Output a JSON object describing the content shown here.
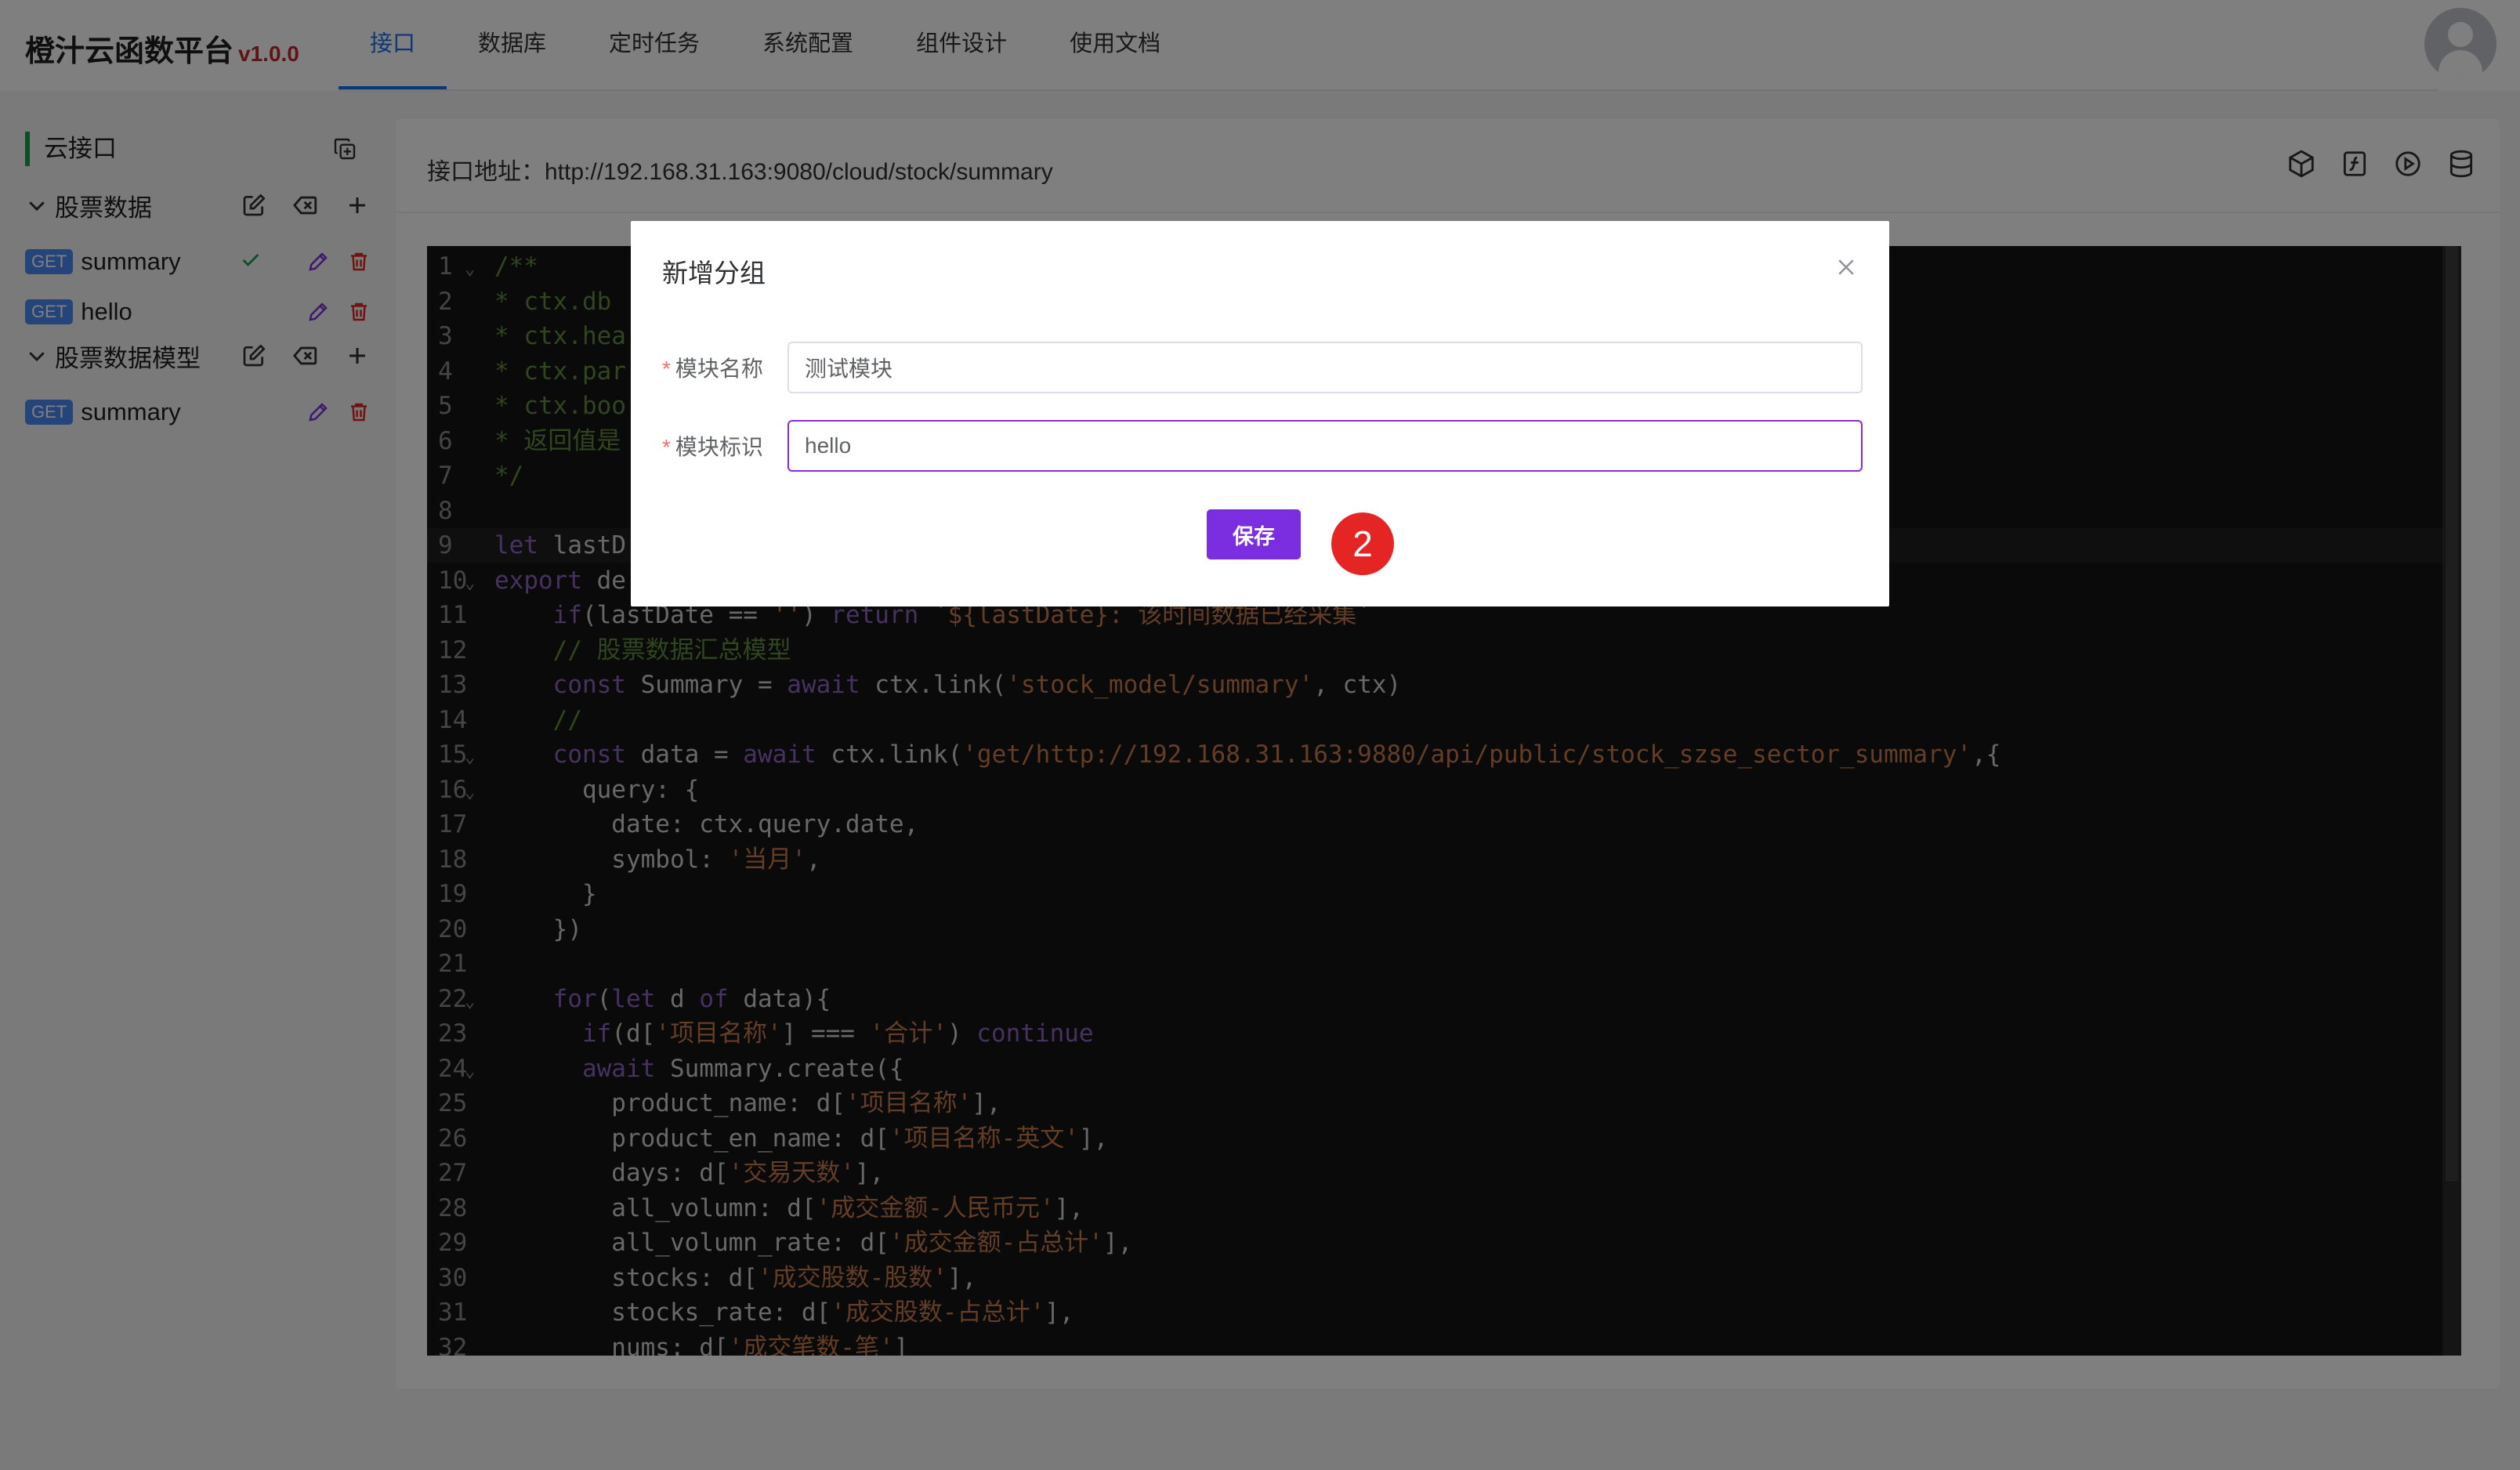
{
  "header": {
    "brand": "橙汁云函数平台",
    "version": "v1.0.0",
    "nav": [
      {
        "label": "接口",
        "active": true
      },
      {
        "label": "数据库",
        "active": false
      },
      {
        "label": "定时任务",
        "active": false
      },
      {
        "label": "系统配置",
        "active": false
      },
      {
        "label": "组件设计",
        "active": false
      },
      {
        "label": "使用文档",
        "active": false
      }
    ]
  },
  "sidebar": {
    "title": "云接口",
    "groups": [
      {
        "name": "股票数据",
        "apis": [
          {
            "method": "GET",
            "name": "summary"
          },
          {
            "method": "GET",
            "name": "hello"
          }
        ]
      },
      {
        "name": "股票数据模型",
        "apis": [
          {
            "method": "GET",
            "name": "summary"
          }
        ]
      }
    ]
  },
  "main": {
    "address_label": "接口地址：",
    "address_url": "http://192.168.31.163:9080/cloud/stock/summary"
  },
  "editor": {
    "lines": [
      "/**",
      "* ctx.db",
      "* ctx.hea",
      "* ctx.par",
      "* ctx.boo",
      "* 返回值是",
      "*/",
      "",
      "let lastD",
      "export de",
      "    if(lastDate == '') return `${lastDate}: 该时间数据已经采集`",
      "    // 股票数据汇总模型",
      "    const Summary = await ctx.link('stock_model/summary', ctx)",
      "    //",
      "    const data = await ctx.link('get/http://192.168.31.163:9880/api/public/stock_szse_sector_summary',{",
      "      query: {",
      "        date: ctx.query.date,",
      "        symbol: '当月',",
      "      }",
      "    })",
      "",
      "    for(let d of data){",
      "      if(d['项目名称'] === '合计') continue",
      "      await Summary.create({",
      "        product_name: d['项目名称'],",
      "        product_en_name: d['项目名称-英文'],",
      "        days: d['交易天数'],",
      "        all_volumn: d['成交金额-人民币元'],",
      "        all_volumn_rate: d['成交金额-占总计'],",
      "        stocks: d['成交股数-股数'],",
      "        stocks_rate: d['成交股数-占总计'],",
      "        nums: d['成交笔数-笔']"
    ]
  },
  "modal": {
    "title": "新增分组",
    "fields": [
      {
        "label": "模块名称",
        "value": "测试模块"
      },
      {
        "label": "模块标识",
        "value": "hello"
      }
    ],
    "save_label": "保存",
    "step_badge": "2"
  },
  "colors": {
    "accent": "#1a6fe8",
    "primary_button": "#7b2ee0",
    "step_badge": "#e52424",
    "group_marker": "#1d9a4a"
  }
}
